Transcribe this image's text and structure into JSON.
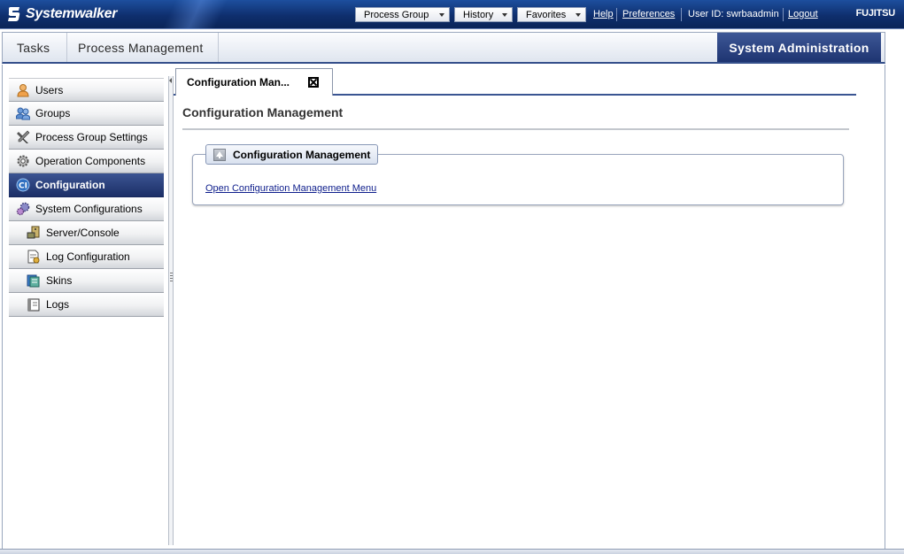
{
  "header": {
    "brand": "Systemwalker",
    "menus": [
      {
        "label": "Process Group",
        "icon": "caret-down-icon"
      },
      {
        "label": "History",
        "icon": "caret-down-icon"
      },
      {
        "label": "Favorites",
        "icon": "caret-down-icon"
      }
    ],
    "help_label": "Help",
    "preferences_label": "Preferences",
    "user_id_text": "User ID: swrbaadmin",
    "logout_label": "Logout",
    "vendor": "FUJITSU"
  },
  "main_tabs": [
    {
      "label": "Tasks"
    },
    {
      "label": "Process Management"
    },
    {
      "label": "System Administration",
      "active": true
    }
  ],
  "sidebar": {
    "items": [
      {
        "label": "Users",
        "icon": "user-icon"
      },
      {
        "label": "Groups",
        "icon": "groups-icon"
      },
      {
        "label": "Process Group Settings",
        "icon": "tools-icon"
      },
      {
        "label": "Operation Components",
        "icon": "gear-icon"
      },
      {
        "label": "Configuration",
        "icon": "ci-icon",
        "active": true
      },
      {
        "label": "System Configurations",
        "icon": "system-config-icon"
      },
      {
        "label": "Server/Console",
        "icon": "server-console-icon",
        "sub": true
      },
      {
        "label": "Log Configuration",
        "icon": "log-config-icon",
        "sub": true
      },
      {
        "label": "Skins",
        "icon": "skins-icon",
        "sub": true
      },
      {
        "label": "Logs",
        "icon": "logs-icon",
        "sub": true
      }
    ]
  },
  "content": {
    "doc_tab_label": "Configuration Man...",
    "page_title": "Configuration Management",
    "group_title": "Configuration Management",
    "open_link": "Open Configuration Management Menu"
  },
  "colors": {
    "banner": "#0f2f6e",
    "active_nav": "#1c2f67",
    "link": "#0e1e8c"
  }
}
